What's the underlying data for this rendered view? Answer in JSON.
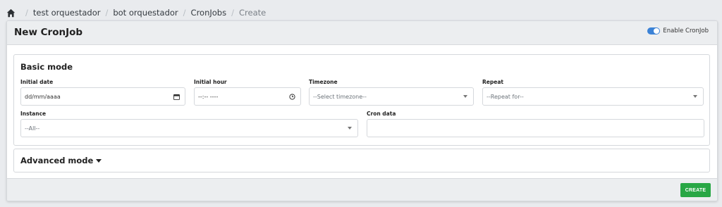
{
  "breadcrumb": {
    "home_icon": "home-icon",
    "items": [
      "test orquestador",
      "bot orquestador",
      "CronJobs"
    ],
    "current": "Create",
    "separator": "/"
  },
  "header": {
    "title": "New CronJob",
    "toggle_label": "Enable CronJob",
    "toggle_on": true,
    "accent_color": "#3b82d6"
  },
  "basic": {
    "title": "Basic mode",
    "initial_date": {
      "label": "Initial date",
      "value": "dd/mm/aaaa",
      "icon": "calendar-icon"
    },
    "initial_hour": {
      "label": "Initial hour",
      "value": "--:-- ----",
      "icon": "clock-icon"
    },
    "timezone": {
      "label": "Timezone",
      "value": "--Select timezone--"
    },
    "repeat": {
      "label": "Repeat",
      "value": "--Repeat for--"
    },
    "instance": {
      "label": "Instance",
      "value": "--All--"
    },
    "cron_data": {
      "label": "Cron data",
      "value": ""
    }
  },
  "advanced": {
    "title": "Advanced mode"
  },
  "footer": {
    "create_label": "CREATE",
    "create_color": "#28a745"
  }
}
